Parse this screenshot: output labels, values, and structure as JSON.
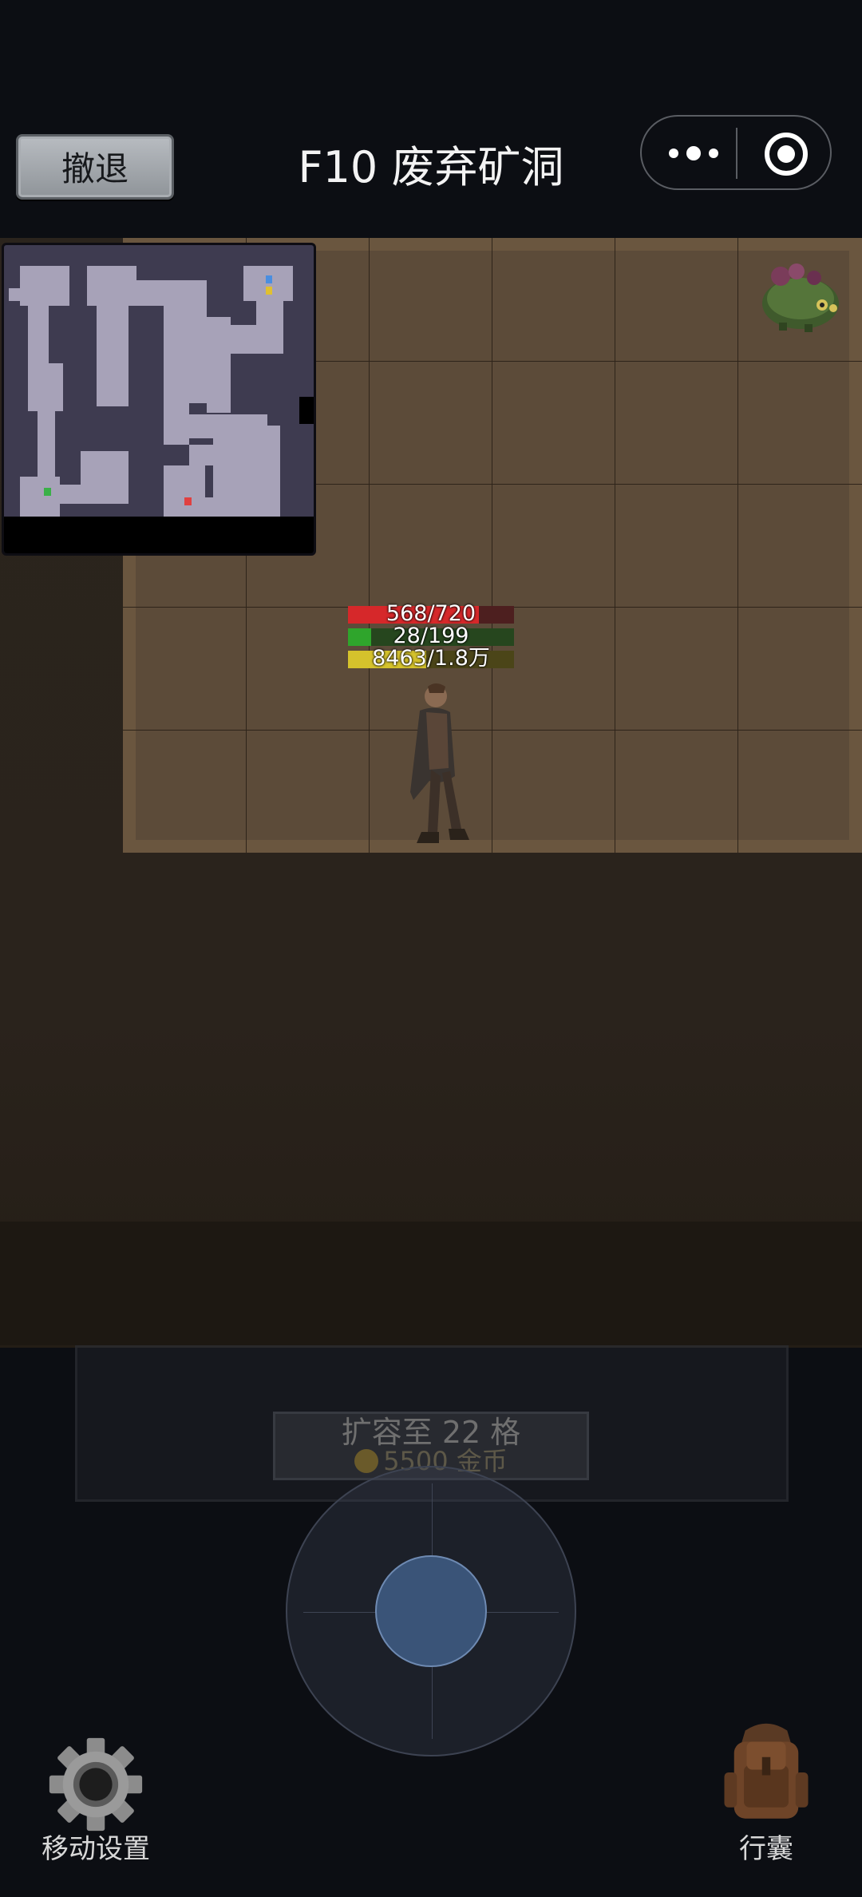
{
  "header": {
    "retreat_label": "撤退",
    "title": "F10 废弃矿洞"
  },
  "minimap": {
    "player_marker_color": "#e04040",
    "exit_marker_color": "#3ab048",
    "item_marker_colors": [
      "#4a8ee0",
      "#e0c030"
    ]
  },
  "player": {
    "hp": {
      "text": "568/720",
      "fraction": 0.789
    },
    "mp": {
      "text": "28/199",
      "fraction": 0.141
    },
    "xp": {
      "text": "8463/1.8万",
      "fraction": 0.47
    }
  },
  "inventory": {
    "expand_label": "扩容至 22 格",
    "expand_cost": "5500 金币"
  },
  "controls": {
    "settings_label": "移动设置",
    "bag_label": "行囊"
  }
}
